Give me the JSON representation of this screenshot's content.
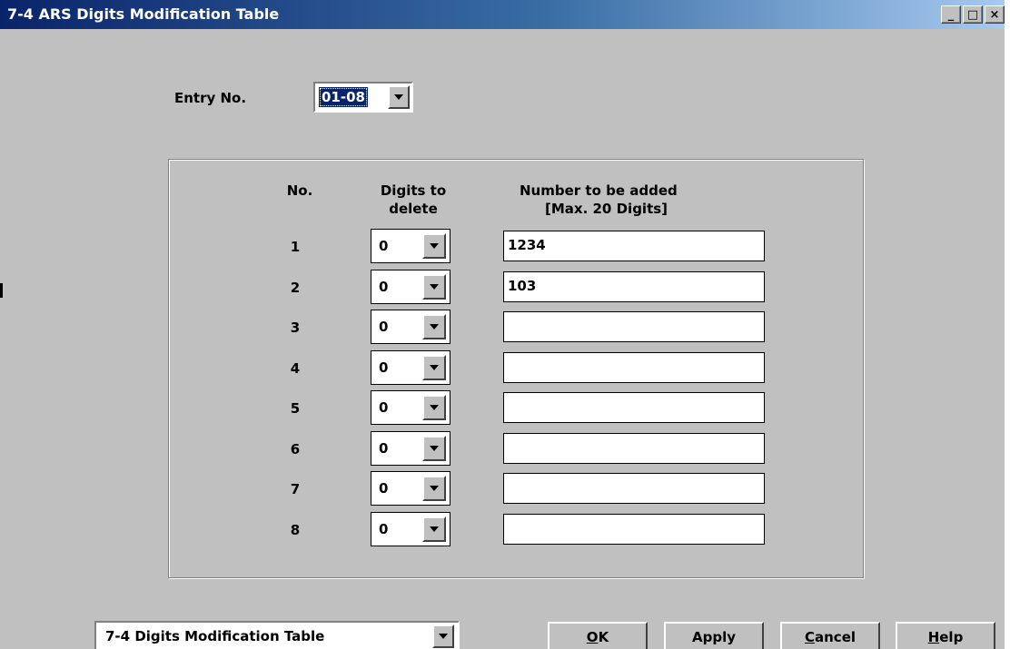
{
  "window": {
    "title": "7-4 ARS Digits Modification Table",
    "controls": {
      "minimize": "_",
      "maximize": "□",
      "close": "×"
    }
  },
  "entry": {
    "label": "Entry No.",
    "value": "01-08"
  },
  "table": {
    "headers": {
      "no": "No.",
      "digits_line1": "Digits to",
      "digits_line2": "delete",
      "number_line1": "Number to be added",
      "number_line2": "[Max. 20 Digits]"
    },
    "rows": [
      {
        "no": "1",
        "digits": "0",
        "number": "1234"
      },
      {
        "no": "2",
        "digits": "0",
        "number": "103"
      },
      {
        "no": "3",
        "digits": "0",
        "number": ""
      },
      {
        "no": "4",
        "digits": "0",
        "number": ""
      },
      {
        "no": "5",
        "digits": "0",
        "number": ""
      },
      {
        "no": "6",
        "digits": "0",
        "number": ""
      },
      {
        "no": "7",
        "digits": "0",
        "number": ""
      },
      {
        "no": "8",
        "digits": "0",
        "number": ""
      }
    ]
  },
  "footer": {
    "page_select": "7-4 Digits Modification Table",
    "buttons": {
      "ok_u": "O",
      "ok_rest": "K",
      "apply": "Apply",
      "cancel_u": "C",
      "cancel_rest": "ancel",
      "help_u": "H",
      "help_rest": "elp"
    }
  },
  "colors": {
    "titlebar_start": "#0a246a",
    "titlebar_end": "#a6caf0",
    "face": "#c0c0c0"
  }
}
